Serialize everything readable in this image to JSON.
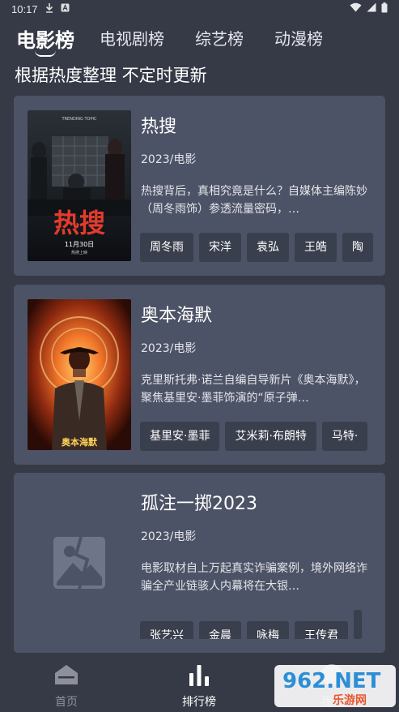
{
  "status_bar": {
    "time": "10:17",
    "icons": [
      "download-icon",
      "font-icon",
      "wifi-icon",
      "signal-icon",
      "battery-icon"
    ]
  },
  "tabs": [
    {
      "label": "电影榜",
      "active": true
    },
    {
      "label": "电视剧榜",
      "active": false
    },
    {
      "label": "综艺榜",
      "active": false
    },
    {
      "label": "动漫榜",
      "active": false
    }
  ],
  "subtitle": "根据热度整理 不定时更新",
  "cards": [
    {
      "title": "热搜",
      "meta": "2023/电影",
      "description": "热搜背后，真相究竟是什么？自媒体主编陈妙（周冬雨饰）参透流量密码，…",
      "chips": [
        "周冬雨",
        "宋洋",
        "袁弘",
        "王皓",
        "陶"
      ],
      "poster": {
        "title_text": "热搜",
        "subtitle_text": "TRENDING TOPIC",
        "date_text": "11月30日",
        "release_text": "热搜上映"
      }
    },
    {
      "title": "奥本海默",
      "meta": "2023/电影",
      "description": "克里斯托弗·诺兰自编自导新片《奥本海默》，聚焦基里安·墨菲饰演的“原子弹…",
      "chips": [
        "基里安·墨菲",
        "艾米莉·布朗特",
        "马特·"
      ],
      "poster": {
        "title_text": "奥本海默"
      }
    },
    {
      "title": "孤注一掷2023",
      "meta": "2023/电影",
      "description": "电影取材自上万起真实诈骗案例，境外网络诈骗全产业链骇人内幕将在大银…",
      "chips": [
        "张艺兴",
        "金晨",
        "咏梅",
        "王传君",
        ""
      ],
      "poster": null
    }
  ],
  "bottom_nav": [
    {
      "label": "首页",
      "icon": "home-icon",
      "active": false
    },
    {
      "label": "排行榜",
      "icon": "bar-chart-icon",
      "active": true
    },
    {
      "label": "我的",
      "icon": "user-icon",
      "active": false
    }
  ],
  "watermark": {
    "text_main": "962.NET",
    "text_sub": "乐游网"
  },
  "colors": {
    "background": "#363a46",
    "card": "#4d5366",
    "chip": "#3a3f4d",
    "accent": "#ffffff",
    "muted": "#8d909a"
  }
}
